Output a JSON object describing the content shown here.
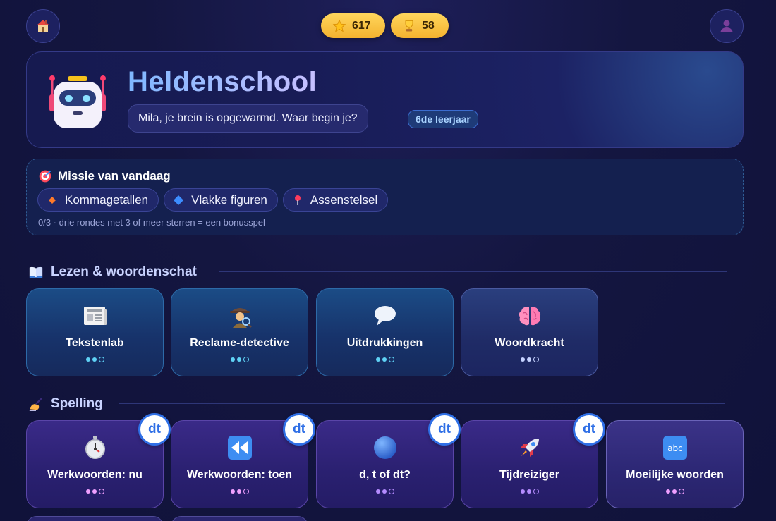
{
  "topbar": {
    "home_icon": "house-icon",
    "profile_icon": "user-icon",
    "stars": "617",
    "trophies": "58"
  },
  "hero": {
    "title": "Heldenschool",
    "message": "Mila, je brein is opgewarmd. Waar begin je?",
    "grade": "6de leerjaar"
  },
  "mission": {
    "title": "Missie van vandaag",
    "chips": [
      {
        "label": "Kommagetallen",
        "icon": "orange-diamond-icon"
      },
      {
        "label": "Vlakke figuren",
        "icon": "blue-diamond-icon"
      },
      {
        "label": "Assenstelsel",
        "icon": "pin-icon"
      }
    ],
    "note": "0/3 · drie rondes met 3 of meer sterren = een bonusspel"
  },
  "sections": {
    "reading": {
      "title": "Lezen & woordenschat",
      "cards": [
        {
          "label": "Tekstenlab",
          "icon": "newspaper-icon",
          "progress": 2,
          "total": 3
        },
        {
          "label": "Reclame-detective",
          "icon": "detective-icon",
          "progress": 2,
          "total": 3
        },
        {
          "label": "Uitdrukkingen",
          "icon": "speech-bubble-icon",
          "progress": 2,
          "total": 3
        },
        {
          "label": "Woordkracht",
          "icon": "brain-icon",
          "progress": 2,
          "total": 3
        }
      ]
    },
    "spelling": {
      "title": "Spelling",
      "badge": "dt",
      "cards": [
        {
          "label": "Werkwoorden: nu",
          "icon": "stopwatch-icon",
          "progress": 2,
          "total": 3
        },
        {
          "label": "Werkwoorden: toen",
          "icon": "rewind-icon",
          "progress": 2,
          "total": 3
        },
        {
          "label": "d, t of dt?",
          "icon": "blue-circle-icon",
          "progress": 2,
          "total": 3
        },
        {
          "label": "Tijdreiziger",
          "icon": "rocket-icon",
          "progress": 2,
          "total": 3
        },
        {
          "label": "Moeilijke woorden",
          "icon": "abc-icon",
          "progress": 2,
          "total": 3
        }
      ]
    }
  },
  "colors": {
    "background": "#141640",
    "gold": "#f4b22f",
    "reading_accent": "#5fd2f5",
    "spelling_accent": "#b58cff",
    "badge_blue": "#2f6fe6"
  }
}
